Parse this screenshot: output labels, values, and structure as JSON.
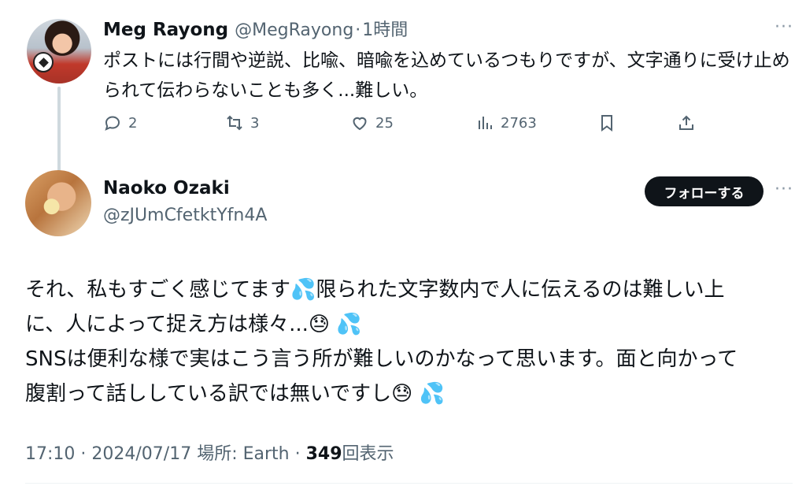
{
  "parent_tweet": {
    "name": "Meg Rayong",
    "handle": "@MegRayong",
    "separator": "·",
    "time": "1時間",
    "text": "ポストには行間や逆説、比喩、暗喩を込めているつもりですが、文字通りに受け止められて伝わらないことも多く...難しい。",
    "actions": {
      "replies": "2",
      "reposts": "3",
      "likes": "25",
      "views": "2763"
    },
    "icons": {
      "reply": "comment-icon",
      "repost": "repost-icon",
      "like": "heart-icon",
      "views": "bar-chart-icon",
      "bookmark": "bookmark-icon",
      "share": "share-icon"
    }
  },
  "reply": {
    "name": "Naoko Ozaki",
    "handle": "@zJUmCfetktYfn4A",
    "follow_label": "フォローする",
    "text_lines": [
      "それ、私もすごく感じてます💦限られた文字数内で人に伝えるのは難しい上",
      "に、人によって捉え方は様々...😓 💦",
      "SNSは便利な様で実はこう言う所が難しいのかなって思います。面と向かって",
      "腹割って話ししている訳では無いですし😓 💦"
    ],
    "meta": {
      "time": "17:10",
      "separator": " · ",
      "date": "2024/07/17",
      "location": "場所: Earth",
      "views_count": "349",
      "views_label": "回表示"
    }
  },
  "more_label": "···",
  "colors": {
    "text_primary": "#0f1419",
    "text_secondary": "#536471",
    "follow_bg": "#0f1419",
    "thread_line": "#cfd9de"
  }
}
